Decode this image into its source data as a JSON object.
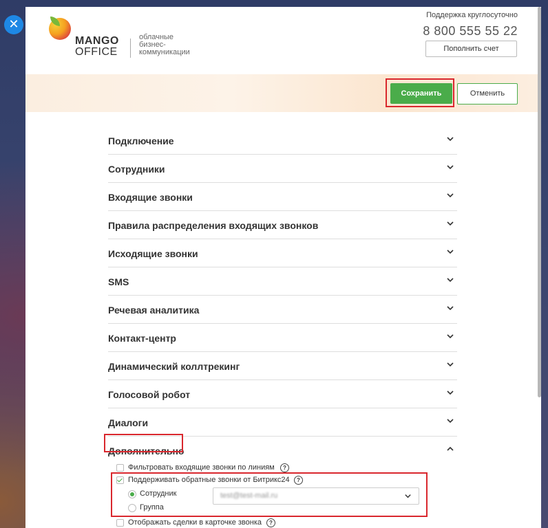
{
  "header": {
    "logo_line1": "MANGO",
    "logo_line2": "OFFICE",
    "tagline_1": "облачные",
    "tagline_2": "бизнес-",
    "tagline_3": "коммуникации",
    "support_label": "Поддержка круглосуточно",
    "phone": "8 800 555 55 22",
    "topup_label": "Пополнить счет"
  },
  "toolbar": {
    "save_label": "Сохранить",
    "cancel_label": "Отменить"
  },
  "sections": [
    {
      "label": "Подключение"
    },
    {
      "label": "Сотрудники"
    },
    {
      "label": "Входящие звонки"
    },
    {
      "label": "Правила распределения входящих звонков"
    },
    {
      "label": "Исходящие звонки"
    },
    {
      "label": "SMS"
    },
    {
      "label": "Речевая аналитика"
    },
    {
      "label": "Контакт-центр"
    },
    {
      "label": "Динамический коллтрекинг"
    },
    {
      "label": "Голосовой робот"
    },
    {
      "label": "Диалоги"
    },
    {
      "label": "Дополнительно"
    }
  ],
  "options": {
    "filter_label": "Фильтровать входящие звонки по линиям",
    "filter_checked": false,
    "bitrix_label": "Поддерживать обратные звонки от Битрикс24",
    "bitrix_checked": true,
    "radio_employee": "Сотрудник",
    "radio_group": "Группа",
    "employee_value": "test@test-mail.ru",
    "deals_label": "Отображать сделки в карточке звонка",
    "deals_checked": false
  },
  "colors": {
    "accent_green": "#4aac4a",
    "highlight_red": "#d9272d",
    "close_blue": "#1e88e5"
  },
  "icons": {
    "close": "close-icon",
    "chevron_down": "chevron-down-icon",
    "chevron_up": "chevron-up-icon",
    "help": "help-icon"
  }
}
